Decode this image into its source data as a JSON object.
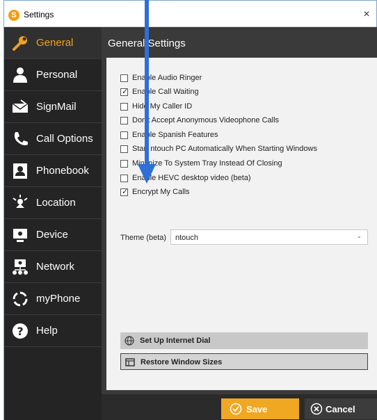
{
  "window": {
    "title": "Settings",
    "close_glyph": "×"
  },
  "sidebar": {
    "items": [
      {
        "label": "General",
        "icon": "wrench-icon",
        "active": true
      },
      {
        "label": "Personal",
        "icon": "person-icon"
      },
      {
        "label": "SignMail",
        "icon": "signmail-icon"
      },
      {
        "label": "Call Options",
        "icon": "call-options-icon"
      },
      {
        "label": "Phonebook",
        "icon": "phonebook-icon"
      },
      {
        "label": "Location",
        "icon": "location-icon"
      },
      {
        "label": "Device",
        "icon": "device-icon"
      },
      {
        "label": "Network",
        "icon": "network-icon"
      },
      {
        "label": "myPhone",
        "icon": "myphone-icon"
      },
      {
        "label": "Help",
        "icon": "help-icon"
      }
    ]
  },
  "main": {
    "title": "General Settings",
    "options": [
      {
        "label": "Enable Audio Ringer",
        "checked": false
      },
      {
        "label": "Enable Call Waiting",
        "checked": true
      },
      {
        "label": "Hide My Caller ID",
        "checked": false
      },
      {
        "label": "Don't Accept Anonymous Videophone Calls",
        "checked": false
      },
      {
        "label": "Enable Spanish Features",
        "checked": false
      },
      {
        "label": "Start ntouch PC Automatically When Starting Windows",
        "checked": false
      },
      {
        "label": "Minimize To System Tray Instead Of Closing",
        "checked": false
      },
      {
        "label": "Enable HEVC desktop video (beta)",
        "checked": false
      },
      {
        "label": "Encrypt My Calls",
        "checked": true
      }
    ],
    "theme": {
      "label": "Theme (beta)",
      "value": "ntouch"
    },
    "internet_dial_label": "Set Up Internet Dial",
    "restore_sizes_label": "Restore Window Sizes"
  },
  "footer": {
    "save_label": "Save",
    "cancel_label": "Cancel"
  },
  "colors": {
    "accent": "#f0a823",
    "sidebar_bg": "#242424",
    "annotation": "#2f6fd6"
  }
}
